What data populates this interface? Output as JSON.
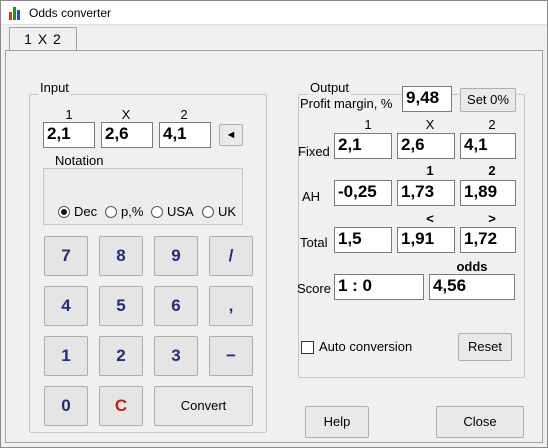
{
  "window": {
    "title": "Odds converter"
  },
  "tabs": [
    {
      "label": "1 X 2"
    }
  ],
  "input": {
    "group_label": "Input",
    "headers": [
      "1",
      "X",
      "2"
    ],
    "values": [
      "2,1",
      "2,6",
      "4,1"
    ],
    "arrow_button": "◄",
    "notation": {
      "label": "Notation",
      "options": [
        "Dec",
        "p,%",
        "USA",
        "UK"
      ],
      "selected": "Dec"
    },
    "keypad": {
      "row1": [
        "7",
        "8",
        "9",
        "/"
      ],
      "row2": [
        "4",
        "5",
        "6",
        ","
      ],
      "row3": [
        "1",
        "2",
        "3",
        "−"
      ],
      "zero": "0",
      "clear": "C",
      "convert": "Convert"
    }
  },
  "output": {
    "group_label": "Output",
    "profit_margin_label": "Profit margin, %",
    "profit_margin_value": "9,48",
    "set0_button": "Set 0%",
    "fixed": {
      "label": "Fixed",
      "headers": [
        "1",
        "X",
        "2"
      ],
      "values": [
        "2,1",
        "2,6",
        "4,1"
      ]
    },
    "ah": {
      "label": "AH",
      "headers": [
        "1",
        "2"
      ],
      "values": [
        "-0,25",
        "1,73",
        "1,89"
      ]
    },
    "total": {
      "label": "Total",
      "headers": [
        "<",
        ">"
      ],
      "values": [
        "1,5",
        "1,91",
        "1,72"
      ]
    },
    "score": {
      "label": "Score",
      "odds_header": "odds",
      "value": "1 : 0",
      "odds": "4,56"
    },
    "auto_conversion_label": "Auto conversion",
    "auto_conversion_checked": false,
    "reset_button": "Reset"
  },
  "footer": {
    "help_button": "Help",
    "close_button": "Close"
  },
  "colors": {
    "keypad_text": "#1f2d7a",
    "clear_text": "#c0201a"
  }
}
